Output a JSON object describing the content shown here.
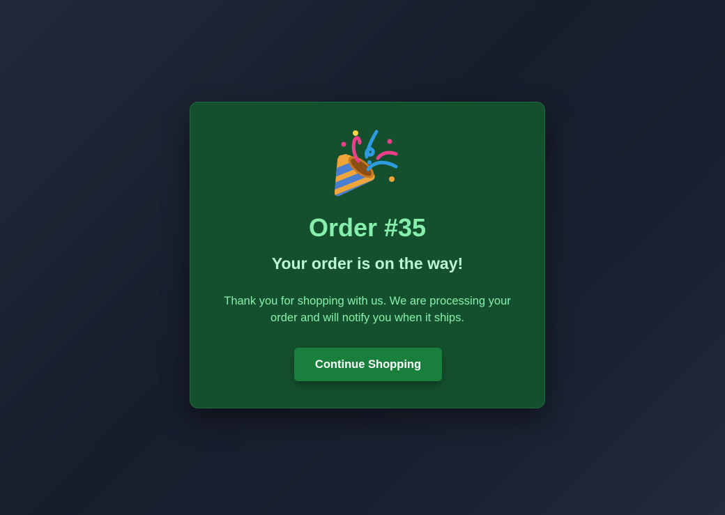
{
  "card": {
    "icon": "party-popper-icon",
    "title": "Order #35",
    "subtitle": "Your order is on the way!",
    "message": "Thank you for shopping with us. We are processing your order and will notify you when it ships.",
    "button_label": "Continue Shopping"
  },
  "colors": {
    "background": "#1b2131",
    "card_background": "#15502e",
    "title": "#86efac",
    "subtitle": "#bbf7d0",
    "button": "#18803c"
  }
}
